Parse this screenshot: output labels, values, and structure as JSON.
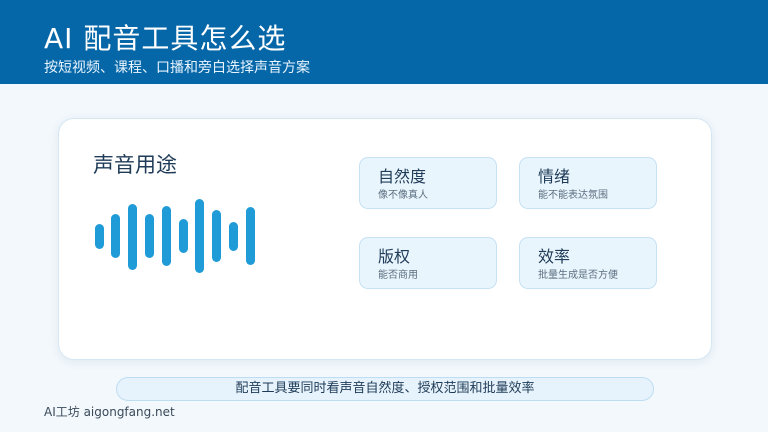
{
  "header": {
    "title": "AI 配音工具怎么选",
    "subtitle": "按短视频、课程、口播和旁白选择声音方案"
  },
  "panel": {
    "usage_title": "声音用途",
    "waveform_icon": "audio-waveform-icon",
    "cards": [
      {
        "title": "自然度",
        "desc": "像不像真人"
      },
      {
        "title": "情绪",
        "desc": "能不能表达氛围"
      },
      {
        "title": "版权",
        "desc": "能否商用"
      },
      {
        "title": "效率",
        "desc": "批量生成是否方便"
      }
    ]
  },
  "summary": "配音工具要同时看声音自然度、授权范围和批量效率",
  "footer": "AI工坊 aigongfang.net",
  "colors": {
    "header_bg": "#0567a8",
    "accent": "#1f9bd7",
    "card_bg": "#e9f5fd",
    "page_bg": "#f2f8fc"
  }
}
